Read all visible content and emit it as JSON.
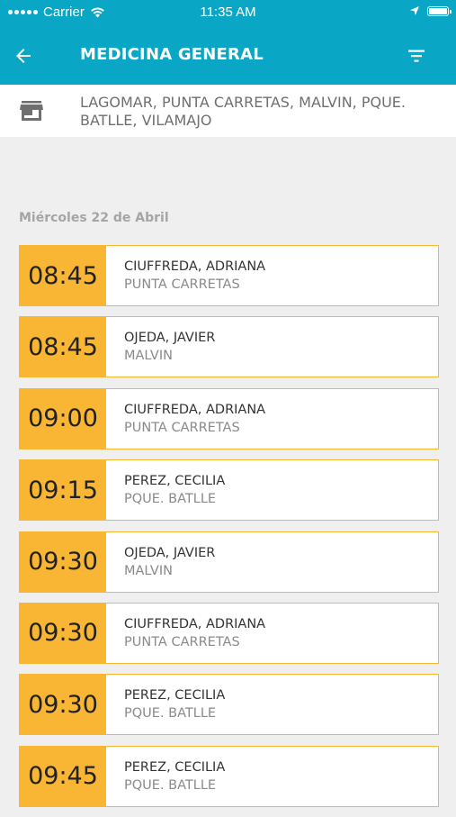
{
  "status_bar": {
    "carrier": "Carrier",
    "time": "11:35 AM"
  },
  "header": {
    "title": "MEDICINA GENERAL",
    "back_icon": "arrow-left-icon",
    "filter_icon": "filter-icon"
  },
  "location": {
    "icon": "store-icon",
    "text": "LAGOMAR, PUNTA CARRETAS, MALVIN, PQUE. BATLLE, VILAMAJO"
  },
  "date_label": "Miércoles 22 de Abril",
  "colors": {
    "primary": "#0aa6c6",
    "accent": "#f8b634"
  },
  "appointments": [
    {
      "time": "08:45",
      "doctor": "CIUFFREDA, ADRIANA",
      "location": "PUNTA CARRETAS"
    },
    {
      "time": "08:45",
      "doctor": "OJEDA, JAVIER",
      "location": "MALVIN"
    },
    {
      "time": "09:00",
      "doctor": "CIUFFREDA, ADRIANA",
      "location": "PUNTA CARRETAS"
    },
    {
      "time": "09:15",
      "doctor": "PEREZ, CECILIA",
      "location": "PQUE. BATLLE"
    },
    {
      "time": "09:30",
      "doctor": "OJEDA, JAVIER",
      "location": "MALVIN"
    },
    {
      "time": "09:30",
      "doctor": "CIUFFREDA, ADRIANA",
      "location": "PUNTA CARRETAS"
    },
    {
      "time": "09:30",
      "doctor": "PEREZ, CECILIA",
      "location": "PQUE. BATLLE"
    },
    {
      "time": "09:45",
      "doctor": "PEREZ, CECILIA",
      "location": "PQUE. BATLLE"
    }
  ]
}
